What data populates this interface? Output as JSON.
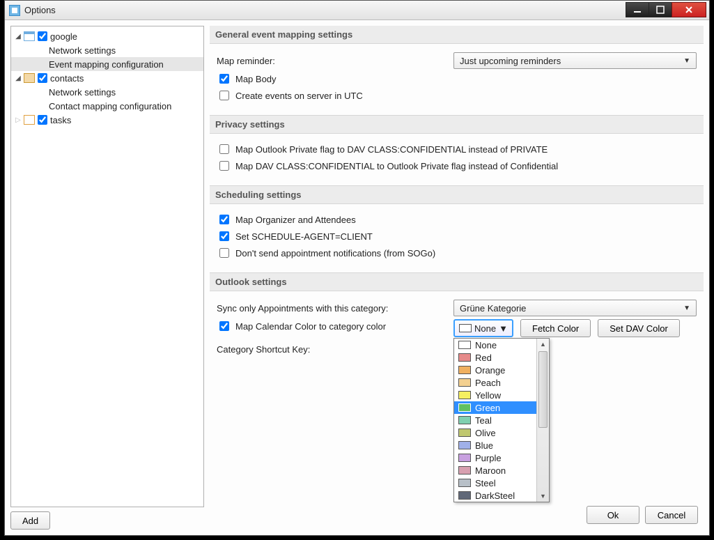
{
  "window": {
    "title": "Options"
  },
  "titlebar_buttons": {
    "minimize": "minimize",
    "maximize": "maximize",
    "close": "close"
  },
  "tree": {
    "google": {
      "label": "google",
      "checked": true,
      "children": {
        "network": "Network settings",
        "event_mapping": "Event mapping configuration"
      }
    },
    "contacts": {
      "label": "contacts",
      "checked": true,
      "children": {
        "network": "Network settings",
        "contact_mapping": "Contact mapping configuration"
      }
    },
    "tasks": {
      "label": "tasks",
      "checked": true
    }
  },
  "buttons": {
    "add": "Add"
  },
  "sections": {
    "general": {
      "title": "General event mapping settings",
      "map_reminder_label": "Map reminder:",
      "map_reminder_value": "Just upcoming reminders",
      "map_body": {
        "label": "Map Body",
        "checked": true
      },
      "utc": {
        "label": "Create events on server in UTC",
        "checked": false
      }
    },
    "privacy": {
      "title": "Privacy settings",
      "opt1": {
        "label": "Map Outlook Private flag to DAV CLASS:CONFIDENTIAL instead of PRIVATE",
        "checked": false
      },
      "opt2": {
        "label": "Map DAV CLASS:CONFIDENTIAL to Outlook Private flag instead of Confidential",
        "checked": false
      }
    },
    "scheduling": {
      "title": "Scheduling settings",
      "organizer": {
        "label": "Map Organizer and Attendees",
        "checked": true
      },
      "schedule_agent": {
        "label": "Set SCHEDULE-AGENT=CLIENT",
        "checked": true
      },
      "no_notify": {
        "label": "Don't send appointment notifications (from SOGo)",
        "checked": false
      }
    },
    "outlook": {
      "title": "Outlook settings",
      "sync_cat_label": "Sync only Appointments with this category:",
      "sync_cat_value": "Grüne Kategorie",
      "map_color": {
        "label": "Map Calendar Color to category color",
        "checked": true
      },
      "color_combo_value": "None",
      "fetch_color": "Fetch Color",
      "set_dav_color": "Set DAV Color",
      "shortcut_label": "Category Shortcut Key:"
    }
  },
  "color_options": [
    {
      "name": "None",
      "bg": "#ffffff"
    },
    {
      "name": "Red",
      "bg": "#e68a8a"
    },
    {
      "name": "Orange",
      "bg": "#f0b060"
    },
    {
      "name": "Peach",
      "bg": "#f3d090"
    },
    {
      "name": "Yellow",
      "bg": "#f5f060"
    },
    {
      "name": "Green",
      "bg": "#60c060",
      "selected": true
    },
    {
      "name": "Teal",
      "bg": "#80d0b0"
    },
    {
      "name": "Olive",
      "bg": "#c0c870"
    },
    {
      "name": "Blue",
      "bg": "#a0b0e8"
    },
    {
      "name": "Purple",
      "bg": "#c8a0e0"
    },
    {
      "name": "Maroon",
      "bg": "#d8a0b0"
    },
    {
      "name": "Steel",
      "bg": "#b8c0c8"
    },
    {
      "name": "DarkSteel",
      "bg": "#606878"
    }
  ],
  "footer": {
    "ok": "Ok",
    "cancel": "Cancel"
  }
}
